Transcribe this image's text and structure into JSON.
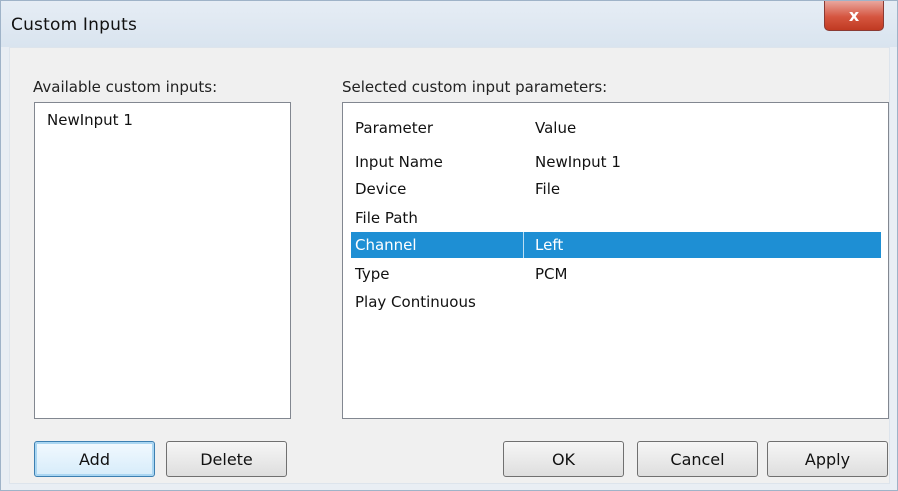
{
  "window": {
    "title": "Custom Inputs",
    "close_label": "x"
  },
  "available": {
    "label": "Available custom inputs:",
    "items": [
      "NewInput 1"
    ]
  },
  "selected": {
    "label": "Selected custom input parameters:",
    "header": {
      "param": "Parameter",
      "value": "Value"
    },
    "rows": [
      {
        "param": "Input Name",
        "value": "NewInput 1"
      },
      {
        "param": "Device",
        "value": "File"
      },
      {
        "param": "File Path",
        "value": ""
      },
      {
        "param": "Channel",
        "value": "Left",
        "selected": true
      },
      {
        "param": "Type",
        "value": "PCM"
      },
      {
        "param": "Play Continuous",
        "value": ""
      }
    ]
  },
  "buttons": {
    "add": "Add",
    "delete": "Delete",
    "ok": "OK",
    "cancel": "Cancel",
    "apply": "Apply"
  },
  "colors": {
    "selection": "#1e8fd4",
    "close_button": "#d5553f"
  }
}
